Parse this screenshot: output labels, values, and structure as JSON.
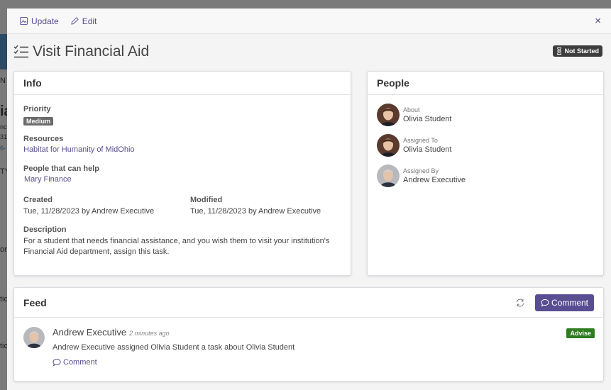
{
  "topbar": {
    "update_label": "Update",
    "edit_label": "Edit",
    "close_label": "×"
  },
  "task": {
    "title": "Visit Financial Aid",
    "status": "Not Started"
  },
  "info": {
    "header": "Info",
    "priority_label": "Priority",
    "priority_value": "Medium",
    "resources_label": "Resources",
    "resources_value": "Habitat for Humanity of MidOhio",
    "helpers_label": "People that can help",
    "helpers_value": "Mary Finance",
    "created_label": "Created",
    "created_value": "Tue, 11/28/2023 by Andrew Executive",
    "modified_label": "Modified",
    "modified_value": "Tue, 11/28/2023 by Andrew Executive",
    "description_label": "Description",
    "description_value": "For a student that needs financial assistance, and you wish them to visit your institution's Financial Aid department, assign this task."
  },
  "people": {
    "header": "People",
    "items": [
      {
        "role": "About",
        "name": "Olivia Student"
      },
      {
        "role": "Assigned To",
        "name": "Olivia Student"
      },
      {
        "role": "Assigned By",
        "name": "Andrew Executive"
      }
    ]
  },
  "feed": {
    "header": "Feed",
    "comment_button": "Comment",
    "entries": [
      {
        "author": "Andrew Executive",
        "time": "2 minutes ago",
        "text": "Andrew Executive assigned Olivia Student a task about Olivia Student",
        "comment_link": "Comment",
        "badge": "Advise"
      }
    ]
  },
  "background": {
    "fragments": [
      "N",
      "ia",
      "nc",
      "31",
      "6-",
      "TY",
      "or",
      "tic",
      "tic"
    ]
  },
  "colors": {
    "accent": "#5a4e93",
    "status_badge": "#3d3d3d",
    "advise_badge": "#2e7d1f",
    "priority_badge": "#6b6b6b"
  },
  "icons": {
    "update": "image-icon",
    "edit": "pencil-icon",
    "title": "checklist-icon",
    "status": "hourglass-icon",
    "refresh": "refresh-icon",
    "comment": "speech-bubble-icon"
  }
}
